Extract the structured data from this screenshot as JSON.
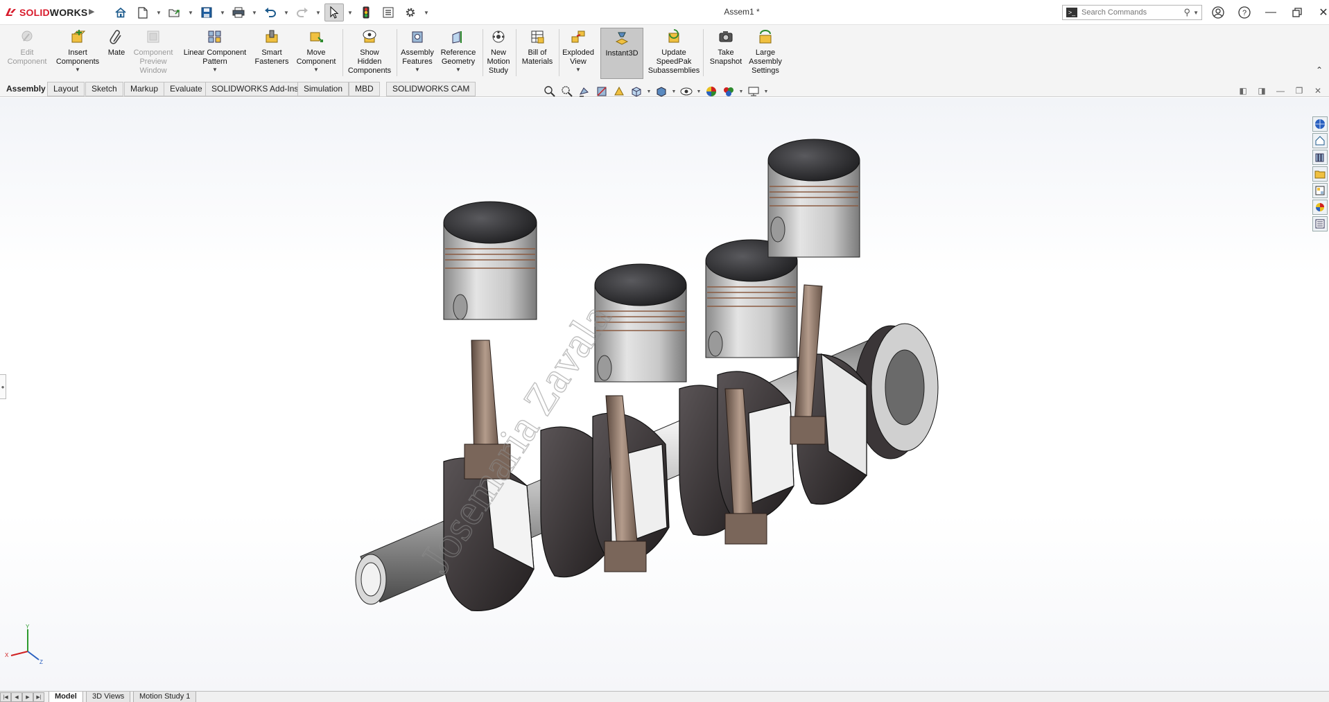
{
  "app": {
    "logo_brand": "SOLID",
    "logo_suffix": "WORKS",
    "document_title": "Assem1 *"
  },
  "search": {
    "placeholder": "Search Commands"
  },
  "quick_access": [
    {
      "icon": "home-icon"
    },
    {
      "icon": "new-document-icon"
    },
    {
      "icon": "open-folder-icon"
    },
    {
      "icon": "save-icon"
    },
    {
      "icon": "print-icon"
    },
    {
      "icon": "undo-icon"
    },
    {
      "icon": "redo-icon"
    },
    {
      "icon": "select-arrow-icon"
    },
    {
      "icon": "rebuild-traffic-light-icon"
    },
    {
      "icon": "file-properties-icon"
    },
    {
      "icon": "options-gear-icon"
    }
  ],
  "commands": {
    "edit_component": "Edit\nComponent",
    "insert_components": "Insert\nComponents",
    "mate": "Mate",
    "component_preview": "Component\nPreview\nWindow",
    "linear_pattern": "Linear Component\nPattern",
    "smart_fasteners": "Smart\nFasteners",
    "move_component": "Move\nComponent",
    "show_hidden": "Show\nHidden\nComponents",
    "assembly_features": "Assembly\nFeatures",
    "reference_geometry": "Reference\nGeometry",
    "new_motion_study": "New\nMotion\nStudy",
    "bill_of_materials": "Bill of\nMaterials",
    "exploded_view": "Exploded\nView",
    "instant3d": "Instant3D",
    "update_speedpak": "Update\nSpeedPak\nSubassemblies",
    "take_snapshot": "Take\nSnapshot",
    "large_assembly": "Large\nAssembly\nSettings"
  },
  "tabs": [
    "Assembly",
    "Layout",
    "Sketch",
    "Markup",
    "Evaluate",
    "SOLIDWORKS Add-Ins",
    "Simulation",
    "MBD",
    "SOLIDWORKS CAM"
  ],
  "active_tab": "Assembly",
  "bottom_tabs": [
    "Model",
    "3D Views",
    "Motion Study 1"
  ],
  "active_bottom_tab": "Model",
  "watermark": "Josemaria Zavala",
  "triad": {
    "x": "X",
    "y": "Y",
    "z": "Z"
  },
  "colors": {
    "brand_red": "#d81b2c",
    "piston_crown": "#2e2e30",
    "piston_skirt": "#cfcfcf",
    "conrod": "#8c7466",
    "crank_web": "#3b3638"
  }
}
